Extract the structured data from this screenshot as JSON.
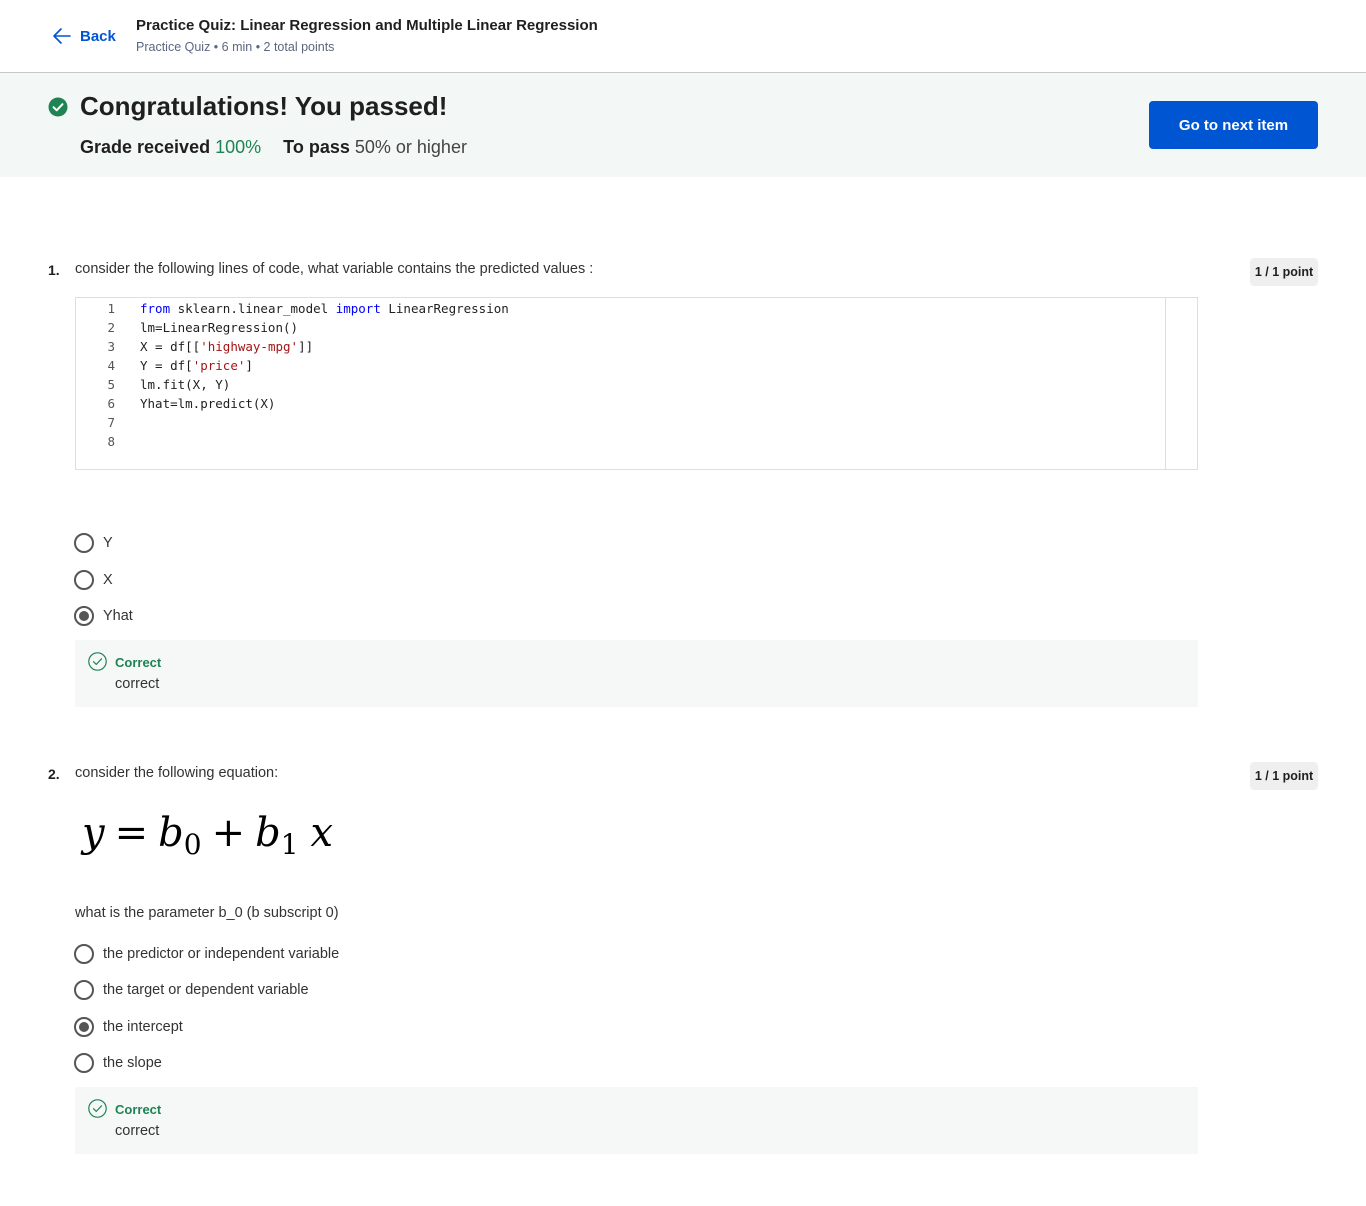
{
  "header": {
    "back_label": "Back",
    "title": "Practice Quiz: Linear Regression and Multiple Linear Regression",
    "subtitle": "Practice Quiz • 6 min • 2 total points"
  },
  "banner": {
    "title": "Congratulations! You passed!",
    "grade_label": "Grade received",
    "grade_value": "100%",
    "pass_label": "To pass",
    "pass_value": "50% or higher",
    "next_button": "Go to next item"
  },
  "questions": [
    {
      "number": "1.",
      "text": "consider the following lines of code, what variable contains the predicted values :",
      "points": "1 / 1 point",
      "code_lines": [
        {
          "n": "1",
          "parts": [
            {
              "t": "from",
              "c": "kw"
            },
            {
              "t": " sklearn.linear_model ",
              "c": ""
            },
            {
              "t": "import",
              "c": "kw"
            },
            {
              "t": " LinearRegression",
              "c": ""
            }
          ]
        },
        {
          "n": "2",
          "parts": [
            {
              "t": "lm=LinearRegression()",
              "c": ""
            }
          ]
        },
        {
          "n": "3",
          "parts": [
            {
              "t": "X = df[[",
              "c": ""
            },
            {
              "t": "'highway-mpg'",
              "c": "str"
            },
            {
              "t": "]]",
              "c": ""
            }
          ]
        },
        {
          "n": "4",
          "parts": [
            {
              "t": "Y = df[",
              "c": ""
            },
            {
              "t": "'price'",
              "c": "str"
            },
            {
              "t": "]",
              "c": ""
            }
          ]
        },
        {
          "n": "5",
          "parts": [
            {
              "t": "lm.fit(X, Y)",
              "c": ""
            }
          ]
        },
        {
          "n": "6",
          "parts": [
            {
              "t": "Yhat=lm.predict(X)",
              "c": ""
            }
          ]
        },
        {
          "n": "7",
          "parts": []
        },
        {
          "n": "8",
          "parts": []
        }
      ],
      "options": [
        {
          "label": "Y",
          "selected": false
        },
        {
          "label": "X",
          "selected": false
        },
        {
          "label": "Yhat",
          "selected": true
        }
      ],
      "feedback": {
        "title": "Correct",
        "body": "correct"
      }
    },
    {
      "number": "2.",
      "text": "consider the following equation:",
      "points": "1 / 1 point",
      "equation": {
        "y": "y",
        "eq": "=",
        "b0": "b",
        "b0_sub": "0",
        "plus": "+",
        "b1": "b",
        "b1_sub": "1",
        "x": "x"
      },
      "prompt": "what is the parameter b_0 (b subscript 0)",
      "options": [
        {
          "label": "the predictor or independent variable",
          "selected": false
        },
        {
          "label": "the target or dependent variable",
          "selected": false
        },
        {
          "label": "the intercept",
          "selected": true
        },
        {
          "label": "the slope",
          "selected": false
        }
      ],
      "feedback": {
        "title": "Correct",
        "body": "correct"
      }
    }
  ],
  "colors": {
    "accent": "#0056d2",
    "success": "#1f8354",
    "banner_bg": "#f3f8f6",
    "keyword": "#0000ff",
    "string": "#a31515"
  }
}
